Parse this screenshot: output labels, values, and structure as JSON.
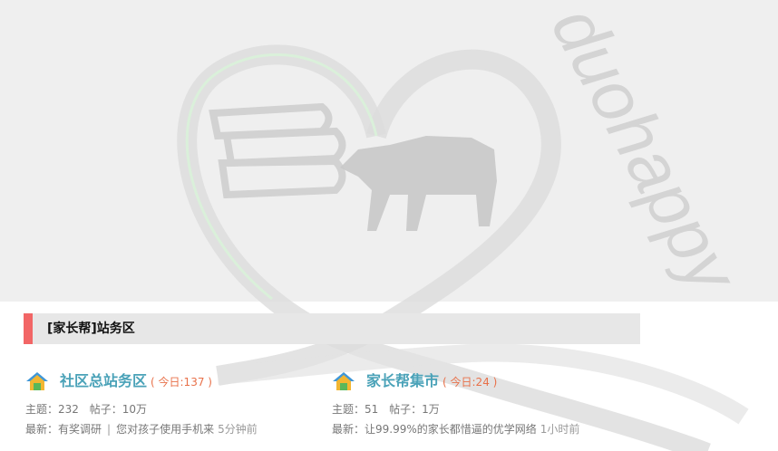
{
  "watermark": {
    "text": "duohappy"
  },
  "section": {
    "title": "[家长帮]站务区",
    "accent_color": "#f26666"
  },
  "forums": [
    {
      "name": "社区总站务区",
      "today": "( 今日:137 )",
      "topics_label": "主题：",
      "topics": "232",
      "posts_label": "帖子：",
      "posts": "10万",
      "latest_label": "最新：",
      "latest_title": "有奖调研",
      "latest_sep": "|",
      "latest_title2": "您对孩子使用手机来",
      "latest_time": "5分钟前"
    },
    {
      "name": "家长帮集市",
      "today": "( 今日:24 )",
      "topics_label": "主题：",
      "topics": "51",
      "posts_label": "帖子：",
      "posts": "1万",
      "latest_label": "最新：",
      "latest_title": "让99.99%的家长都惜逼的优学网络",
      "latest_time": "1小时前"
    }
  ],
  "colors": {
    "forum_name": "#4aa2b8",
    "today_count": "#e8714a",
    "banner_bg": "#efefef"
  }
}
